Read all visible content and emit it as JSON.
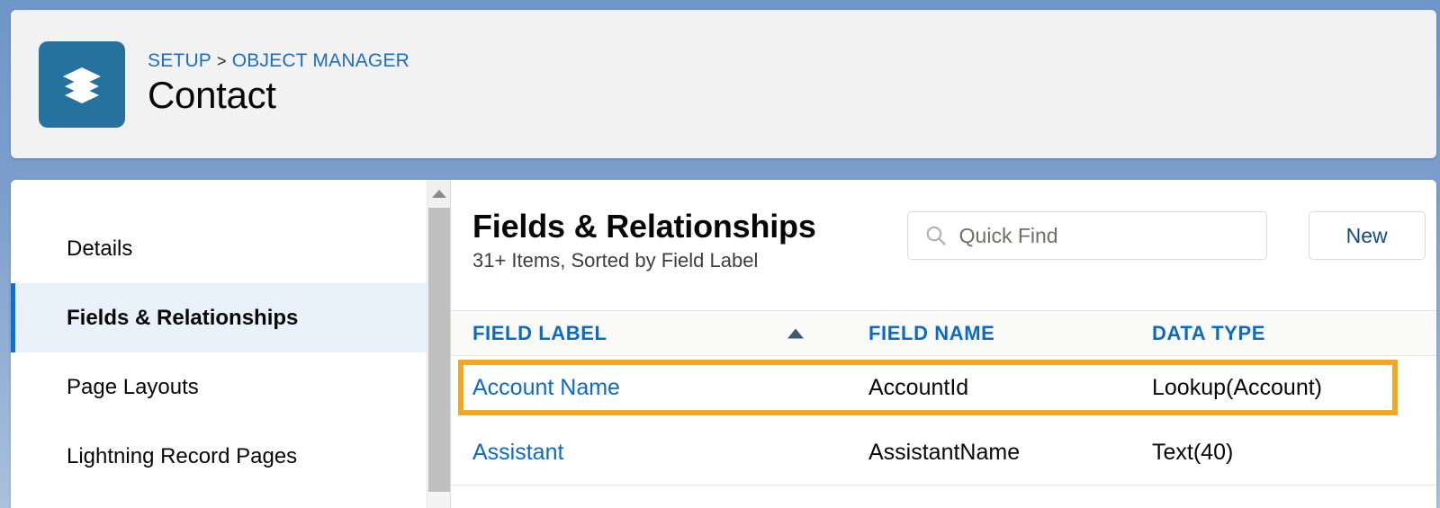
{
  "header": {
    "icon": "layers-stack-icon",
    "icon_bg": "#24729d",
    "breadcrumb": {
      "items": [
        {
          "label": "SETUP"
        },
        {
          "label": "OBJECT MANAGER"
        }
      ],
      "separator": ">"
    },
    "title": "Contact"
  },
  "sidebar": {
    "items": [
      {
        "label": "Details",
        "active": false
      },
      {
        "label": "Fields & Relationships",
        "active": true
      },
      {
        "label": "Page Layouts",
        "active": false
      },
      {
        "label": "Lightning Record Pages",
        "active": false
      }
    ],
    "active_accent_color": "#0f6fce",
    "active_bg_color": "#e9f1fb"
  },
  "scrollbar": {
    "up_arrow_icon": "triangle-up-icon",
    "thumb_name": "scroll-thumb"
  },
  "main": {
    "title": "Fields & Relationships",
    "subtitle": "31+ Items, Sorted by Field Label",
    "search": {
      "icon": "search-icon",
      "placeholder": "Quick Find",
      "value": ""
    },
    "buttons": [
      {
        "label": "New"
      }
    ],
    "table": {
      "columns": [
        {
          "label": "FIELD LABEL",
          "sorted": true,
          "sort_icon": "triangle-up-icon",
          "sort_direction": "ascending"
        },
        {
          "label": "FIELD NAME",
          "sorted": false
        },
        {
          "label": "DATA TYPE",
          "sorted": false
        }
      ],
      "rows": [
        {
          "field_label": "Account Name",
          "field_name": "AccountId",
          "data_type": "Lookup(Account)",
          "highlighted": true
        },
        {
          "field_label": "Assistant",
          "field_name": "AssistantName",
          "data_type": "Text(40)",
          "highlighted": false
        }
      ]
    }
  },
  "annotation": {
    "color": "#f5a623",
    "target": "account-name-row"
  }
}
